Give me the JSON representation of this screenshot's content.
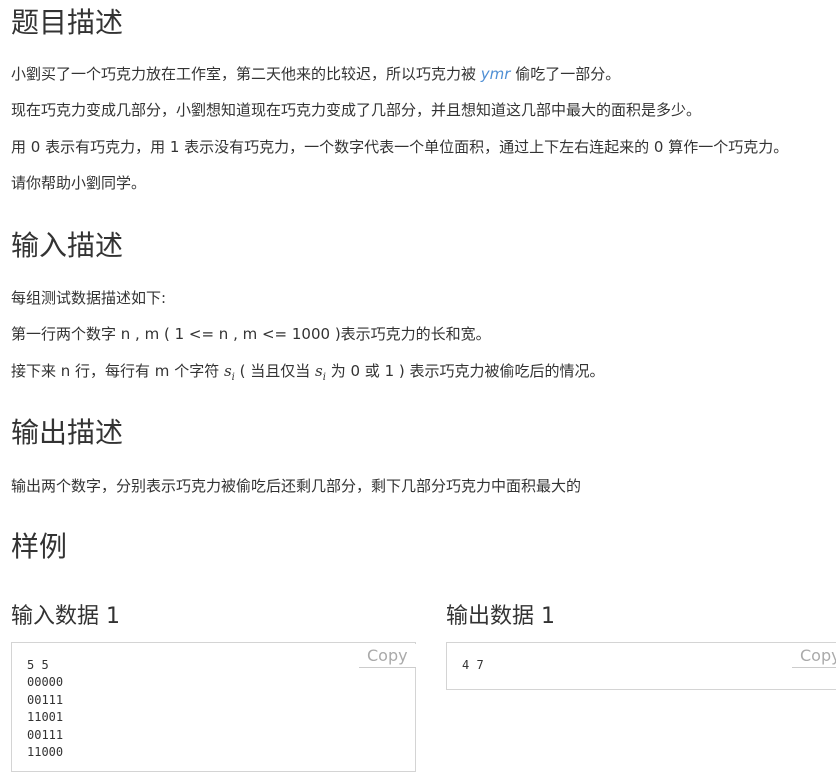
{
  "headings": {
    "description": "题目描述",
    "input": "输入描述",
    "output": "输出描述",
    "samples": "样例"
  },
  "description": {
    "p1_before": "小劉买了一个巧克力放在工作室，第二天他来的比较迟，所以巧克力被 ",
    "p1_name": "ymr",
    "p1_after": " 偷吃了一部分。",
    "p2": "现在巧克力变成几部分，小劉想知道现在巧克力变成了几部分，并且想知道这几部中最大的面积是多少。",
    "p3": "用 0 表示有巧克力，用 1 表示没有巧克力，一个数字代表一个单位面积，通过上下左右连起来的 0 算作一个巧克力。",
    "p4": "请你帮助小劉同学。"
  },
  "input_desc": {
    "p1": "每组测试数据描述如下:",
    "p2": "第一行两个数字 n , m ( 1 <= n , m <= 1000 )表示巧克力的长和宽。",
    "p3_before": "接下来 n 行，每行有 m 个字符 ",
    "p3_mid": " ( 当且仅当 ",
    "p3_after": " 为 0 或 1 ) 表示巧克力被偷吃后的情况。",
    "math_var": "s",
    "math_sub": "i"
  },
  "output_desc": {
    "p1": "输出两个数字，分别表示巧克力被偷吃后还剩几部分，剩下几部分巧克力中面积最大的"
  },
  "samples": {
    "input_title": "输入数据 1",
    "output_title": "输出数据 1",
    "input_content": "5 5\n00000\n00111\n11001\n00111\n11000",
    "output_content": "4 7",
    "copy_label": "Copy"
  }
}
